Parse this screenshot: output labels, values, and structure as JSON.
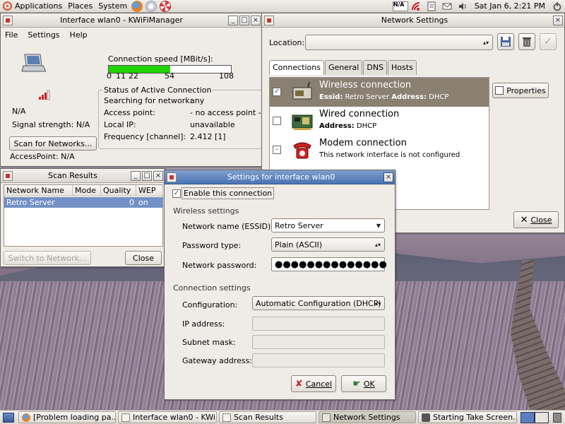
{
  "top_panel": {
    "menus": [
      "Applications",
      "Places",
      "System"
    ],
    "tray_na": "N/A",
    "clock": "Sat Jan  6,  2:21 PM"
  },
  "kwifi": {
    "title": "Interface wlan0 - KWiFiManager",
    "menu": [
      "File",
      "Settings",
      "Help"
    ],
    "speed_label": "Connection speed [MBit/s]:",
    "speed_ticks": [
      "0",
      "11",
      "22",
      "54",
      "108"
    ],
    "speed_fraction": 0.5,
    "signal_na": "N/A",
    "signal_strength": "Signal strength: N/A",
    "scan_button": "Scan for Networks...",
    "access_point": "AccessPoint: N/A",
    "status_group": "Status of Active Connection",
    "status_rows": [
      {
        "label": "Searching for network:",
        "value": "any"
      },
      {
        "label": "Access point:",
        "value": "- no access point -"
      },
      {
        "label": "Local IP:",
        "value": "unavailable"
      },
      {
        "label": "Frequency [channel]:",
        "value": "2.412 [1]"
      }
    ]
  },
  "netset": {
    "title": "Network Settings",
    "location_label": "Location:",
    "location_value": "",
    "tabs": [
      "Connections",
      "General",
      "DNS",
      "Hosts"
    ],
    "connections": [
      {
        "title": "Wireless connection",
        "sub_bold1": "Essid:",
        "sub_val1": "Retro Server",
        "sub_bold2": "Address:",
        "sub_val2": "DHCP",
        "checked": "✓"
      },
      {
        "title": "Wired connection",
        "sub_bold1": "Address:",
        "sub_val1": "DHCP"
      },
      {
        "title": "Modem connection",
        "sub_val1": "This network interface is not configured"
      }
    ],
    "properties_button": "Properties",
    "close_button": "Close"
  },
  "scan": {
    "title": "Scan Results",
    "columns": [
      "Network Name",
      "Mode",
      "Quality",
      "WEP"
    ],
    "rows": [
      {
        "name": "Retro Server",
        "mode": "",
        "quality": "0",
        "wep": "on"
      }
    ],
    "switch_button": "Switch to Network...",
    "close_button": "Close"
  },
  "dialog": {
    "title": "Settings for interface wlan0",
    "enable_label": "Enable this connection",
    "enable_checked": "✓",
    "wireless_section": "Wireless settings",
    "essid_label": "Network name (ESSID):",
    "essid_value": "Retro Server",
    "pwtype_label": "Password type:",
    "pwtype_value": "Plain (ASCII)",
    "password_label": "Network password:",
    "password_value": "●●●●●●●●●●●●●●",
    "connection_section": "Connection settings",
    "config_label": "Configuration:",
    "config_value": "Automatic Configuration (DHCP)",
    "ip_label": "IP address:",
    "subnet_label": "Subnet mask:",
    "gateway_label": "Gateway address:",
    "cancel_button": "Cancel",
    "ok_button": "OK"
  },
  "taskbar": {
    "tasks": [
      "[Problem loading pa...",
      "Interface wlan0 - KWi...",
      "Scan Results",
      "Network Settings",
      "Starting Take Screen..."
    ]
  },
  "colors": {
    "speed_fill": "#21d300",
    "selection": "#7290c4",
    "active_title": "#4a74b4"
  }
}
